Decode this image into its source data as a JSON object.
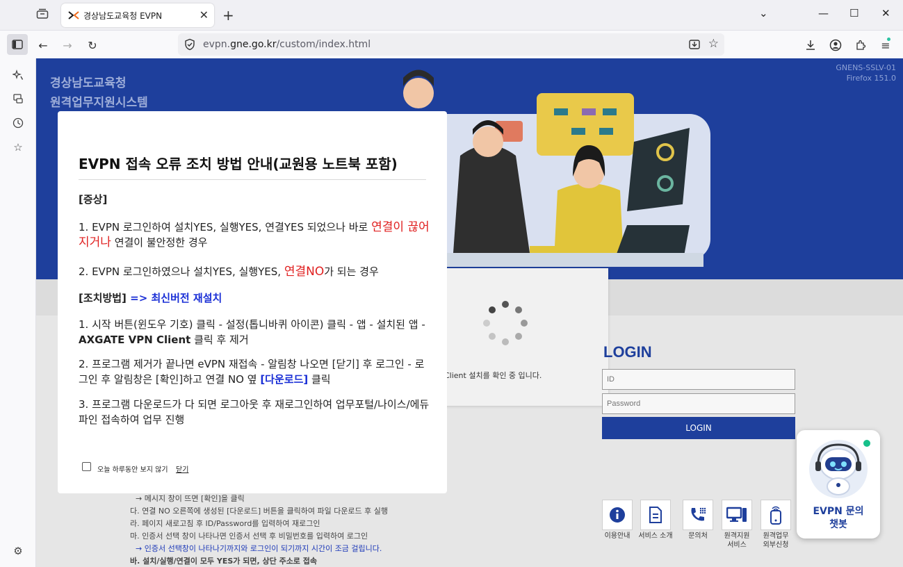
{
  "browser": {
    "tab_title": "경상남도교육청 EVPN",
    "url_prefix": "evpn.",
    "url_domain": "gne.go.kr",
    "url_path": "/custom/index.html"
  },
  "hero": {
    "title_line1": "경상남도교육청",
    "title_line2": "원격업무지원시스템",
    "build_line1": "GNENS-SSLV-01",
    "build_line2": "Firefox 151.0"
  },
  "loading": {
    "message": "Client 설치를 확인 중 입니다."
  },
  "login": {
    "title": "LOGIN",
    "id_placeholder": "ID",
    "password_placeholder": "Password",
    "button": "LOGIN"
  },
  "quick_links": [
    {
      "label": "이용안내",
      "icon": "info-icon"
    },
    {
      "label": "서비스 소개",
      "icon": "document-icon"
    },
    {
      "label": "문의처",
      "icon": "phone-icon"
    },
    {
      "label": "원격지원\n서비스",
      "icon": "remote-support-icon"
    },
    {
      "label": "원격업무\n외부신청",
      "icon": "mobile-apply-icon"
    }
  ],
  "bg_notes": [
    "→ 메시지 창이 뜨면 [확인]을 클릭",
    "다. 연결 NO 오른쪽에 생성된 [다운로드] 버튼을 클릭하여 파일 다운로드 후 실행",
    "라. 페이지 새로고침 후 ID/Password를 입력하여 재로그인",
    "마. 인증서 선택 창이 나타나면 인증서 선택 후 비밀번호를 입력하여 로그인",
    "→ 인증서 선택창이 나타나기까지와 로그인이 되기까지 시간이 조금 걸립니다.",
    "바. 설치/실행/연결이 모두 YES가 되면, 상단 주소로 접속"
  ],
  "chatbot": {
    "line1": "EVPN 문의",
    "line2": "챗봇"
  },
  "modal": {
    "title": "EVPN 접속 오류 조치 방법 안내(교원용 노트북 포함)",
    "symptom_header": "[증상]",
    "s1_a": "1. EVPN 로그인하여 설치YES, 실행YES, 연결YES 되었으나 바로 ",
    "s1_red": "연결이 끊어지거나",
    "s1_b": " 연결이 불안정한 경우",
    "s2_a": "2. EVPN 로그인하였으나 설치YES, 실행YES, ",
    "s2_red": "연결NO",
    "s2_b": "가 되는 경우",
    "action_header": "[조치방법]",
    "action_blue": " => 최신버전 재설치",
    "a1_a": "1. 시작 버튼(윈도우 기호) 클릭 - 설정(톱니바퀴 아이콘) 클릭 - 앱 - 설치된 앱 - ",
    "a1_bold": "AXGATE VPN Client",
    "a1_b": " 클릭 후 제거",
    "a2_a": "2. 프로그램 제거가 끝나면 eVPN 재접속 - 알림창 나오면 [닫기] 후 로그인 - 로그인 후 알림창은 [확인]하고 연결 NO 옆 ",
    "a2_blue": "[다운로드]",
    "a2_b": " 클릭",
    "a3": "3. 프로그램 다운로드가 다 되면 로그아웃 후 재로그인하여 업무포털/나이스/에듀파인 접속하여 업무 진행",
    "dont_show": "오늘 하루동안 보지 않기",
    "close": "닫기"
  }
}
